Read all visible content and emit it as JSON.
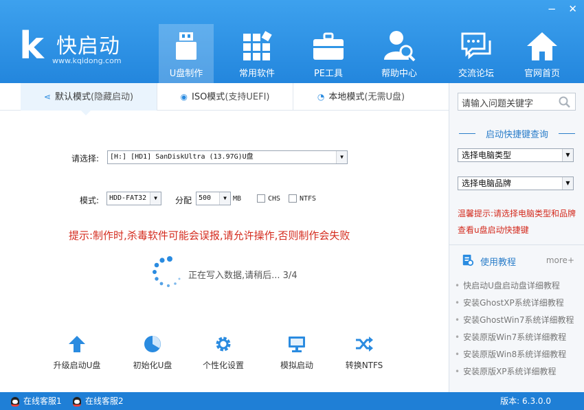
{
  "app": {
    "brand": "快启动",
    "url": "www.kqidong.com",
    "minimize": "−",
    "close": "✕"
  },
  "nav": [
    {
      "label": "U盘制作",
      "icon": "usb-drive-icon"
    },
    {
      "label": "常用软件",
      "icon": "apps-grid-icon"
    },
    {
      "label": "PE工具",
      "icon": "toolbox-icon"
    },
    {
      "label": "帮助中心",
      "icon": "user-search-icon"
    },
    {
      "label": "交流论坛",
      "icon": "chat-bubbles-icon"
    },
    {
      "label": "官网首页",
      "icon": "home-icon"
    }
  ],
  "tabs": [
    {
      "label": "默认模式",
      "sub": "(隐藏启动)",
      "icon": "share-icon"
    },
    {
      "label": "ISO模式",
      "sub": "(支持UEFI)",
      "icon": "disc-icon"
    },
    {
      "label": "本地模式",
      "sub": "(无需U盘)",
      "icon": "wifi-icon"
    }
  ],
  "form": {
    "select_label": "请选择:",
    "disk_value": "[H:] [HD1] SanDiskUltra (13.97G)U盘",
    "mode_label": "模式:",
    "mode_value": "HDD-FAT32",
    "alloc_label": "分配",
    "alloc_value": "500",
    "alloc_unit": "MB",
    "chs_label": "CHS",
    "ntfs_label": "NTFS"
  },
  "warning": "提示:制作时,杀毒软件可能会误报,请允许操作,否则制作会失败",
  "progress": {
    "text": "正在写入数据,请稍后... 3/4"
  },
  "tools": [
    {
      "label": "升级启动U盘",
      "icon": "upload-arrow-icon"
    },
    {
      "label": "初始化U盘",
      "icon": "pie-icon"
    },
    {
      "label": "个性化设置",
      "icon": "gear-icon"
    },
    {
      "label": "模拟启动",
      "icon": "monitor-icon"
    },
    {
      "label": "转换NTFS",
      "icon": "shuffle-icon"
    }
  ],
  "sidebar": {
    "search_placeholder": "请输入问题关键字",
    "shortcut_title": "启动快捷键查询",
    "pc_type": "选择电脑类型",
    "pc_brand": "选择电脑品牌",
    "tip": "温馨提示:请选择电脑类型和品牌查看u盘启动快捷键",
    "tutorial_title": "使用教程",
    "more": "more+",
    "tutorials": [
      "快启动U盘启动盘详细教程",
      "安装GhostXP系统详细教程",
      "安装GhostWin7系统详细教程",
      "安装原版Win7系统详细教程",
      "安装原版Win8系统详细教程",
      "安装原版XP系统详细教程"
    ]
  },
  "status": {
    "service1": "在线客服1",
    "service2": "在线客服2",
    "version": "版本: 6.3.0.0"
  },
  "colors": {
    "header": "#2386dd",
    "accent": "#2a8be0",
    "warning": "#d42b1e",
    "statusbar": "#1f7fd6"
  }
}
